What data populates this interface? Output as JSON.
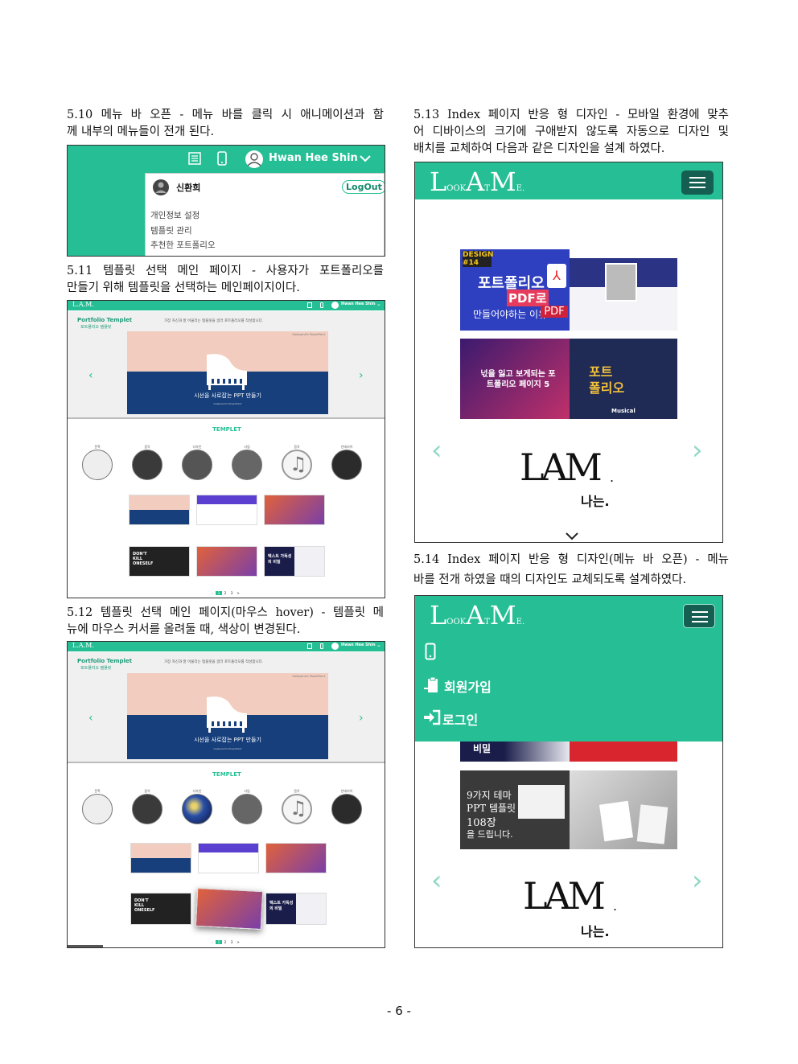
{
  "sections": {
    "s510": {
      "lines": [
        "5.10 메뉴 바 오픈 - 메뉴 바를 클릭 시 애니메이션과 함",
        "께 내부의 메뉴들이 전개 된다."
      ]
    },
    "s511": {
      "lines": [
        "5.11 템플릿 선택 메인 페이지 - 사용자가 포트폴리오를",
        "만들기 위해 템플릿을 선택하는 메인페이지이다."
      ]
    },
    "s512": {
      "lines": [
        "5.12 템플릿 선택 메인 페이지(마우스 hover) - 템플릿 메",
        "뉴에 마우스 커서를 올려둘 때, 색상이 변경된다."
      ]
    },
    "s513": {
      "lines": [
        "5.13 Index 페이지 반응 형 디자인 - 모바일 환경에 맞추",
        "어 디바이스의 크기에 구애받지 않도록 자동으로 디자인 및",
        "배치를 교체하여 다음과 같은 디자인을 설계 하였다."
      ]
    },
    "s514": {
      "lines": [
        "5.14 Index 페이지 반응 형 디자인(메뉴 바 오픈) - 메뉴",
        "바를 전개 하였을 때의 디자인도 교체되도록 설계하였다."
      ]
    }
  },
  "shot510": {
    "user_name": "Hwan Hee Shin",
    "dropdown_user": "신환희",
    "logout": "LogOut",
    "menu_items": [
      "개인정보 설정",
      "템플릿 관리",
      "추천한 포트폴리오"
    ]
  },
  "template_page": {
    "logo": "L.A.M.",
    "user_name": "Hwan Hee Shin",
    "heading_en": "Portfolio Templet",
    "heading_ko": "포트폴리오 템플릿",
    "intro": "가장 자신과 잘 어울리는 템플릿을 골라 포트폴리오를 작성합니다.",
    "slide_brand": "Gaekyand's PowerPoint",
    "slide_title": "시선을 사로잡는 PPT 만들기",
    "slide_sub": "Gaekyand's PowerPoint",
    "section_label": "TEMPLET",
    "categories": [
      "문학",
      "음악",
      "디자인",
      "사업",
      "음악",
      "인테리어"
    ],
    "thumb_texts": [
      "DON'T KILL ONESELF",
      "텍스트 가독성의 비밀"
    ],
    "pages": [
      "1",
      "2",
      "3",
      ">"
    ],
    "prev": "‹",
    "next": "›"
  },
  "shot513": {
    "logo": [
      "L",
      "OOK",
      "A",
      "T",
      "M",
      "E",
      "."
    ],
    "card1_badge": "DESIGN #14",
    "card1_title": "포트폴리오",
    "card1_pdf": "PDF로",
    "card1_sub": "만들어야하는 이유",
    "card1_pdf_label": "PDF",
    "card3_text": "넋을 잃고 보게되는 포트폴리오 페이지 5",
    "card4_text": "포트 폴리오",
    "card4_small": "Musical",
    "lam": "LAM",
    "lam_dot": ".",
    "lam_sub": "나는.",
    "arrow_left": "‹",
    "arrow_right": "›",
    "chevron": "⌄"
  },
  "shot514": {
    "logo": [
      "L",
      "OOK",
      "A",
      "T",
      "M",
      "E",
      "."
    ],
    "menu": [
      "회원가입",
      "로그인"
    ],
    "peek_text": "비밀",
    "card_text": [
      "9가지 테마",
      "PPT 템플릿",
      "108장",
      "을 드립니다."
    ],
    "lam": "LAM",
    "lam_dot": ".",
    "lam_sub": "나는.",
    "arrow_left": "‹",
    "arrow_right": "›"
  },
  "page_number": "- 6 -"
}
